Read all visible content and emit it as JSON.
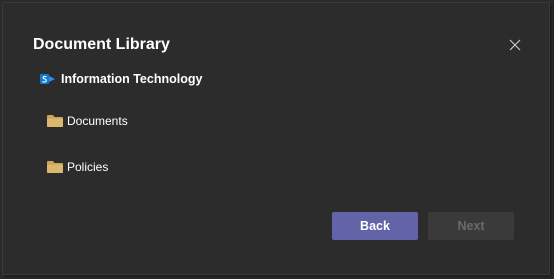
{
  "dialog": {
    "title": "Document Library",
    "close_icon": "close-icon"
  },
  "site": {
    "icon": "sharepoint-icon",
    "name": "Information Technology"
  },
  "folders": [
    {
      "icon": "folder-icon",
      "label": "Documents"
    },
    {
      "icon": "folder-icon",
      "label": "Policies"
    }
  ],
  "footer": {
    "back_label": "Back",
    "next_label": "Next",
    "next_enabled": false
  },
  "colors": {
    "dialog_bg": "#2d2c2c",
    "primary_button": "#6264a7",
    "disabled_button": "#3b3a3a",
    "disabled_text": "#6b6a6a",
    "folder": "#d6b46a",
    "sharepoint_blue": "#0f78d4"
  }
}
